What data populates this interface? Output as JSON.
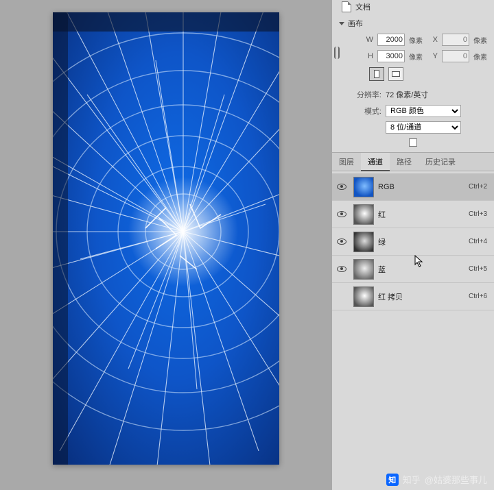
{
  "doc_label": "文档",
  "canvas_section": "画布",
  "fields": {
    "w_label": "W",
    "w_value": "2000",
    "w_unit": "像素",
    "x_label": "X",
    "x_value": "0",
    "x_unit": "像素",
    "h_label": "H",
    "h_value": "3000",
    "h_unit": "像素",
    "y_label": "Y",
    "y_value": "0",
    "y_unit": "像素",
    "res_label": "分辨率:",
    "res_text": "72 像素/英寸",
    "mode_label": "模式:",
    "mode_value": "RGB 颜色",
    "bits_value": "8 位/通道"
  },
  "tabs": [
    "图层",
    "通道",
    "路径",
    "历史记录"
  ],
  "active_tab": "通道",
  "channels": [
    {
      "name": "RGB",
      "shortcut": "Ctrl+2",
      "visible": true,
      "selected": true,
      "preview": "blue"
    },
    {
      "name": "红",
      "shortcut": "Ctrl+3",
      "visible": true,
      "selected": false,
      "preview": "gray1"
    },
    {
      "name": "绿",
      "shortcut": "Ctrl+4",
      "visible": true,
      "selected": false,
      "preview": "gray2"
    },
    {
      "name": "蓝",
      "shortcut": "Ctrl+5",
      "visible": true,
      "selected": false,
      "preview": "gray3"
    },
    {
      "name": "红 拷贝",
      "shortcut": "Ctrl+6",
      "visible": false,
      "selected": false,
      "preview": "gray1"
    }
  ],
  "watermark": {
    "logo": "知",
    "brand": "知乎",
    "user": "@姑婆那些事儿"
  }
}
